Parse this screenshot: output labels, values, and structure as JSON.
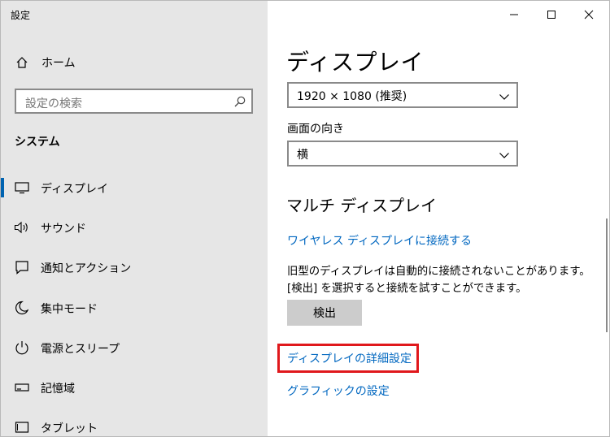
{
  "app_title": "設定",
  "sidebar": {
    "home_label": "ホーム",
    "search_placeholder": "設定の検索",
    "section_title": "システム",
    "items": [
      {
        "label": "ディスプレイ",
        "icon": "monitor-icon",
        "selected": true
      },
      {
        "label": "サウンド",
        "icon": "speaker-icon",
        "selected": false
      },
      {
        "label": "通知とアクション",
        "icon": "notification-icon",
        "selected": false
      },
      {
        "label": "集中モード",
        "icon": "moon-icon",
        "selected": false
      },
      {
        "label": "電源とスリープ",
        "icon": "power-icon",
        "selected": false
      },
      {
        "label": "記憶域",
        "icon": "storage-icon",
        "selected": false
      },
      {
        "label": "タブレット",
        "icon": "tablet-icon",
        "selected": false
      }
    ]
  },
  "window_controls": {
    "minimize": "minimize-icon",
    "maximize": "maximize-icon",
    "close": "close-icon"
  },
  "main": {
    "title": "ディスプレイ",
    "resolution_value": "1920 × 1080 (推奨)",
    "orientation_label": "画面の向き",
    "orientation_value": "横",
    "multi_display_heading": "マルチ ディスプレイ",
    "wireless_link": "ワイヤレス ディスプレイに接続する",
    "description": "旧型のディスプレイは自動的に接続されないことがあります。[検出] を選択すると接続を試すことができます。",
    "detect_button": "検出",
    "advanced_link": "ディスプレイの詳細設定",
    "graphics_link": "グラフィックの設定"
  },
  "colors": {
    "accent": "#0067c0",
    "sidebar_bg": "#e6e6e6",
    "highlight_border": "#e0181c",
    "selection_bar": "#0063b1"
  }
}
